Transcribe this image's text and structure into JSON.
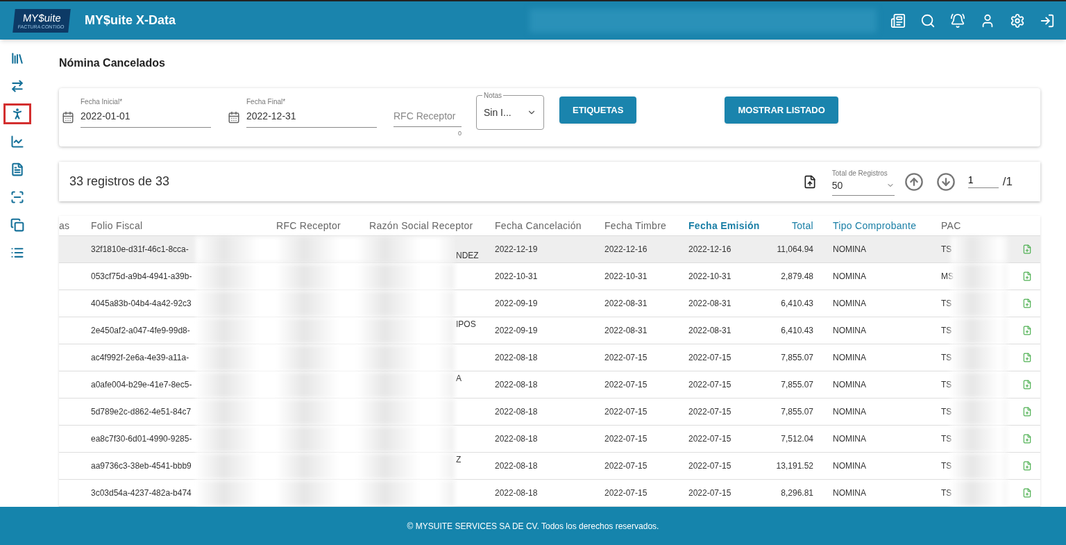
{
  "header": {
    "logo": {
      "main": "MY$uite",
      "tagline": "FACTURA CONTIGO"
    },
    "title": "MY$uite X-Data"
  },
  "sidebar": {
    "items": [
      {
        "selected": false
      },
      {
        "selected": false
      },
      {
        "selected": true
      },
      {
        "selected": false
      },
      {
        "selected": false
      },
      {
        "selected": false
      },
      {
        "selected": false
      },
      {
        "selected": false
      }
    ]
  },
  "page_title": "Nómina Cancelados",
  "filters": {
    "fecha_inicial": {
      "label": "Fecha Inicial*",
      "value": "2022-01-01"
    },
    "fecha_final": {
      "label": "Fecha Final*",
      "value": "2022-12-31"
    },
    "rfc": {
      "placeholder": "RFC Receptor",
      "counter": "0"
    },
    "notas": {
      "label": "Notas",
      "value": "Sin I..."
    },
    "buttons": [
      "ETIQUETAS",
      "MOSTRAR LISTADO"
    ]
  },
  "summary": {
    "text": "33 registros de 33",
    "page_size": {
      "label": "Total de Registros",
      "value": "50"
    },
    "page": "1",
    "pages": "/1"
  },
  "table": {
    "columns": [
      {
        "label": "as",
        "kind": "plain"
      },
      {
        "label": "Folio Fiscal",
        "kind": "plain"
      },
      {
        "label": "RFC Receptor",
        "kind": "plain"
      },
      {
        "label": "Razón Social Receptor",
        "kind": "plain"
      },
      {
        "label": "Fecha Cancelación",
        "kind": "plain"
      },
      {
        "label": "Fecha Timbre",
        "kind": "plain"
      },
      {
        "label": "Fecha Emisión",
        "kind": "sorted"
      },
      {
        "label": "Total",
        "kind": "sortable"
      },
      {
        "label": "Tipo Comprobante",
        "kind": "sortable"
      },
      {
        "label": "PAC",
        "kind": "plain"
      }
    ],
    "rows": [
      {
        "selected": true,
        "folio": "32f1810e-d31f-46c1-8cca-",
        "razon": "NDEZ",
        "cancelacion": "2022-12-19",
        "timbre": "2022-12-16",
        "emision": "2022-12-16",
        "total": "11,064.94",
        "tipo": "NOMINA",
        "pac": "TS"
      },
      {
        "selected": false,
        "folio": "053cf75d-a9b4-4941-a39b-",
        "cancelacion": "2022-10-31",
        "timbre": "2022-10-31",
        "emision": "2022-10-31",
        "total": "2,879.48",
        "tipo": "NOMINA",
        "pac": "MS"
      },
      {
        "selected": false,
        "folio": "4045a83b-04b4-4a42-92c3",
        "cancelacion": "2022-09-19",
        "timbre": "2022-08-31",
        "emision": "2022-08-31",
        "total": "6,410.43",
        "tipo": "NOMINA",
        "pac": "TS"
      },
      {
        "selected": false,
        "folio": "2e450af2-a047-4fe9-99d8-",
        "razon": "IPOS",
        "cancelacion": "2022-09-19",
        "timbre": "2022-08-31",
        "emision": "2022-08-31",
        "total": "6,410.43",
        "tipo": "NOMINA",
        "pac": "TS"
      },
      {
        "selected": false,
        "folio": "ac4f992f-2e6a-4e39-a11a-",
        "cancelacion": "2022-08-18",
        "timbre": "2022-07-15",
        "emision": "2022-07-15",
        "total": "7,855.07",
        "tipo": "NOMINA",
        "pac": "TS"
      },
      {
        "selected": false,
        "folio": "a0afe004-b29e-41e7-8ec5-",
        "razon": "A",
        "cancelacion": "2022-08-18",
        "timbre": "2022-07-15",
        "emision": "2022-07-15",
        "total": "7,855.07",
        "tipo": "NOMINA",
        "pac": "TS"
      },
      {
        "selected": false,
        "folio": "5d789e2c-d862-4e51-84c7",
        "cancelacion": "2022-08-18",
        "timbre": "2022-07-15",
        "emision": "2022-07-15",
        "total": "7,855.07",
        "tipo": "NOMINA",
        "pac": "TS"
      },
      {
        "selected": false,
        "folio": "ea8c7f30-6d01-4990-9285-",
        "cancelacion": "2022-08-18",
        "timbre": "2022-07-15",
        "emision": "2022-07-15",
        "total": "7,512.04",
        "tipo": "NOMINA",
        "pac": "TS"
      },
      {
        "selected": false,
        "folio": "aa9736c3-38eb-4541-bbb9",
        "razon": "Z",
        "cancelacion": "2022-08-18",
        "timbre": "2022-07-15",
        "emision": "2022-07-15",
        "total": "13,191.52",
        "tipo": "NOMINA",
        "pac": "TS"
      },
      {
        "selected": false,
        "folio": "3c03d54a-4237-482a-b474",
        "cancelacion": "2022-08-18",
        "timbre": "2022-07-15",
        "emision": "2022-07-15",
        "total": "8,296.81",
        "tipo": "NOMINA",
        "pac": "TS"
      }
    ]
  },
  "footer": "© MYSUITE SERVICES SA DE CV. Todos los derechos reservados."
}
